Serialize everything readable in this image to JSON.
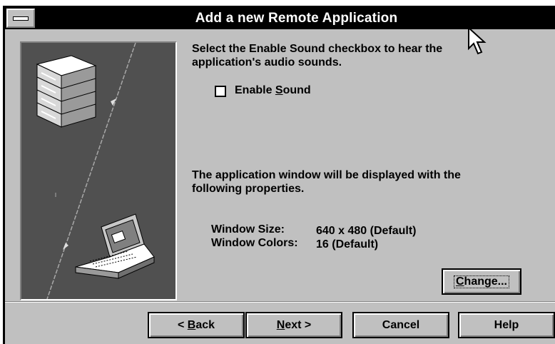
{
  "window": {
    "title": "Add a new Remote Application"
  },
  "content": {
    "intro_line1": "Select the Enable Sound checkbox to hear the",
    "intro_line2": "application's audio sounds.",
    "checkbox": {
      "label_prefix": "Enable ",
      "label_accel": "S",
      "label_suffix": "ound",
      "checked": false
    },
    "properties_line1": "The application window will be displayed with the",
    "properties_line2": "following properties.",
    "window_size_label": "Window Size:",
    "window_size_value": "640 x 480 (Default)",
    "window_colors_label": "Window Colors:",
    "window_colors_value": "16 (Default)"
  },
  "buttons": {
    "change": {
      "label_accel": "C",
      "label_rest": "hange..."
    },
    "back": {
      "label_prefix": "< ",
      "label_accel": "B",
      "label_rest": "ack"
    },
    "next": {
      "label_accel": "N",
      "label_rest": "ext >"
    },
    "cancel": "Cancel",
    "help": "Help"
  },
  "icons": [
    "system-menu-icon",
    "mouse-pointer-icon",
    "server-stack-icon",
    "laptop-icon"
  ],
  "colors": {
    "titlebar": "#000000",
    "title_text": "#ffffff",
    "dialog_face": "#c0c0c0",
    "illustration_bg": "#505050"
  }
}
